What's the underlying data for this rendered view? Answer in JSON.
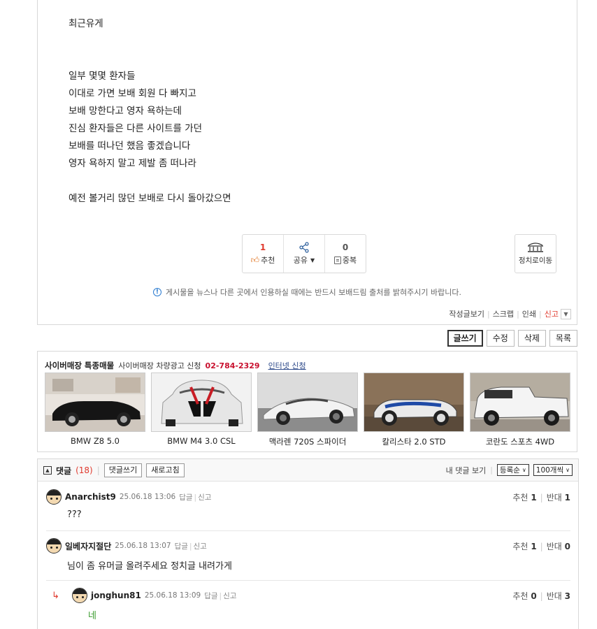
{
  "post": {
    "lines": [
      "최근유게",
      "",
      "",
      "일부 몇몇 환자들",
      "이대로 가면 보배 회원 다 빠지고",
      "보배 망한다고 영자 욕하는데",
      "진심  환자들은 다른 사이트를 가던",
      "보배를 떠나던 했음 좋겠습니다",
      "영자 욕하지 말고 제발 좀 떠나라",
      "",
      "예전 볼거리 많던 보배로 다시 돌아갔으면"
    ]
  },
  "votes": {
    "recommend_count": "1",
    "recommend_label": "추천",
    "share_label": "공유",
    "duplicate_count": "0",
    "duplicate_label": "중복",
    "politics_label": "정치로이동"
  },
  "notice": "게시물을 뉴스나 다른 곳에서 인용하실 때에는 반드시 보배드림 출처를 밝혀주시기 바랍니다.",
  "post_links": {
    "view_posts": "작성글보기",
    "scrap": "스크랩",
    "print": "인쇄",
    "report": "신고"
  },
  "actions": {
    "write": "글쓰기",
    "edit": "수정",
    "delete": "삭제",
    "list": "목록"
  },
  "ad": {
    "title": "사이버매장 특종매물",
    "subtitle": "사이버매장 차량광고 신청",
    "phone": "02-784-2329",
    "link": "인터넷 신청",
    "cars": [
      {
        "name": "BMW Z8 5.0"
      },
      {
        "name": "BMW M4 3.0 CSL"
      },
      {
        "name": "맥라렌 720S 스파이더"
      },
      {
        "name": "칼리스타 2.0 STD"
      },
      {
        "name": "코란도 스포츠 4WD"
      }
    ]
  },
  "comments_header": {
    "title": "댓글",
    "count": "(18)",
    "write_btn": "댓글쓰기",
    "refresh_btn": "새로고침",
    "my_comments": "내 댓글 보기",
    "sort_select": "등록순",
    "per_page_select": "100개씩"
  },
  "comments": [
    {
      "name": "Anarchist9",
      "date": "25.06.18 13:06",
      "reply": "답글",
      "report": "신고",
      "text": "???",
      "rec_label": "추천",
      "rec": "1",
      "opp_label": "반대",
      "opp": "1"
    },
    {
      "name": "일베자지절단",
      "date": "25.06.18 13:07",
      "reply": "답글",
      "report": "신고",
      "text": "님이 좀 유머글 올려주세요 정치글 내려가게",
      "rec_label": "추천",
      "rec": "1",
      "opp_label": "반대",
      "opp": "0"
    },
    {
      "name": "jonghun81",
      "date": "25.06.18 13:09",
      "reply": "답글",
      "report": "신고",
      "text": "네",
      "rec_label": "추천",
      "rec": "0",
      "opp_label": "반대",
      "opp": "3"
    }
  ],
  "colors": {
    "accent_red": "#e03a2e",
    "phone_red": "#c8102e",
    "reply_green": "#3a9b2d",
    "link_blue": "#2e4a8a"
  }
}
